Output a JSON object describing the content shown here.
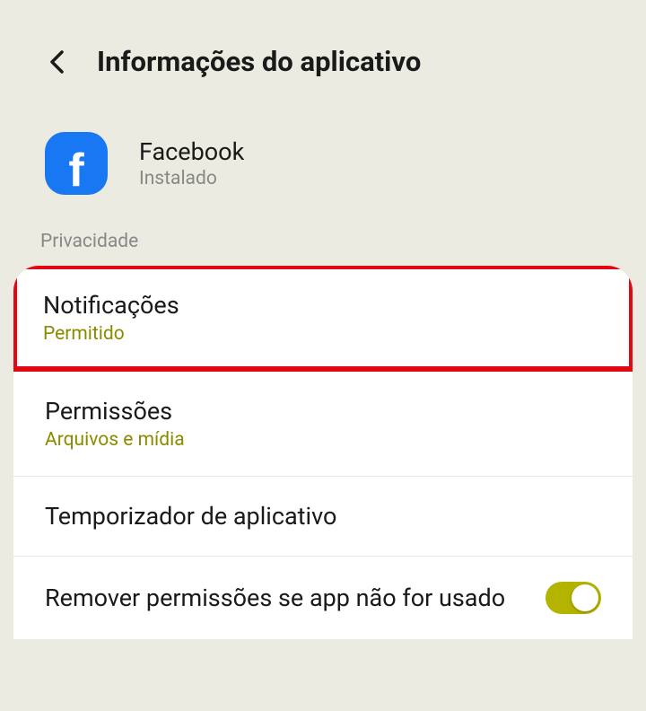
{
  "header": {
    "title": "Informações do aplicativo"
  },
  "app": {
    "name": "Facebook",
    "status": "Instalado"
  },
  "section": {
    "label": "Privacidade"
  },
  "settings": {
    "notifications": {
      "title": "Notificações",
      "subtitle": "Permitido"
    },
    "permissions": {
      "title": "Permissões",
      "subtitle": "Arquivos e mídia"
    },
    "timer": {
      "title": "Temporizador de aplicativo"
    },
    "removePermissions": {
      "title": "Remover permissões se app não for usado"
    }
  }
}
